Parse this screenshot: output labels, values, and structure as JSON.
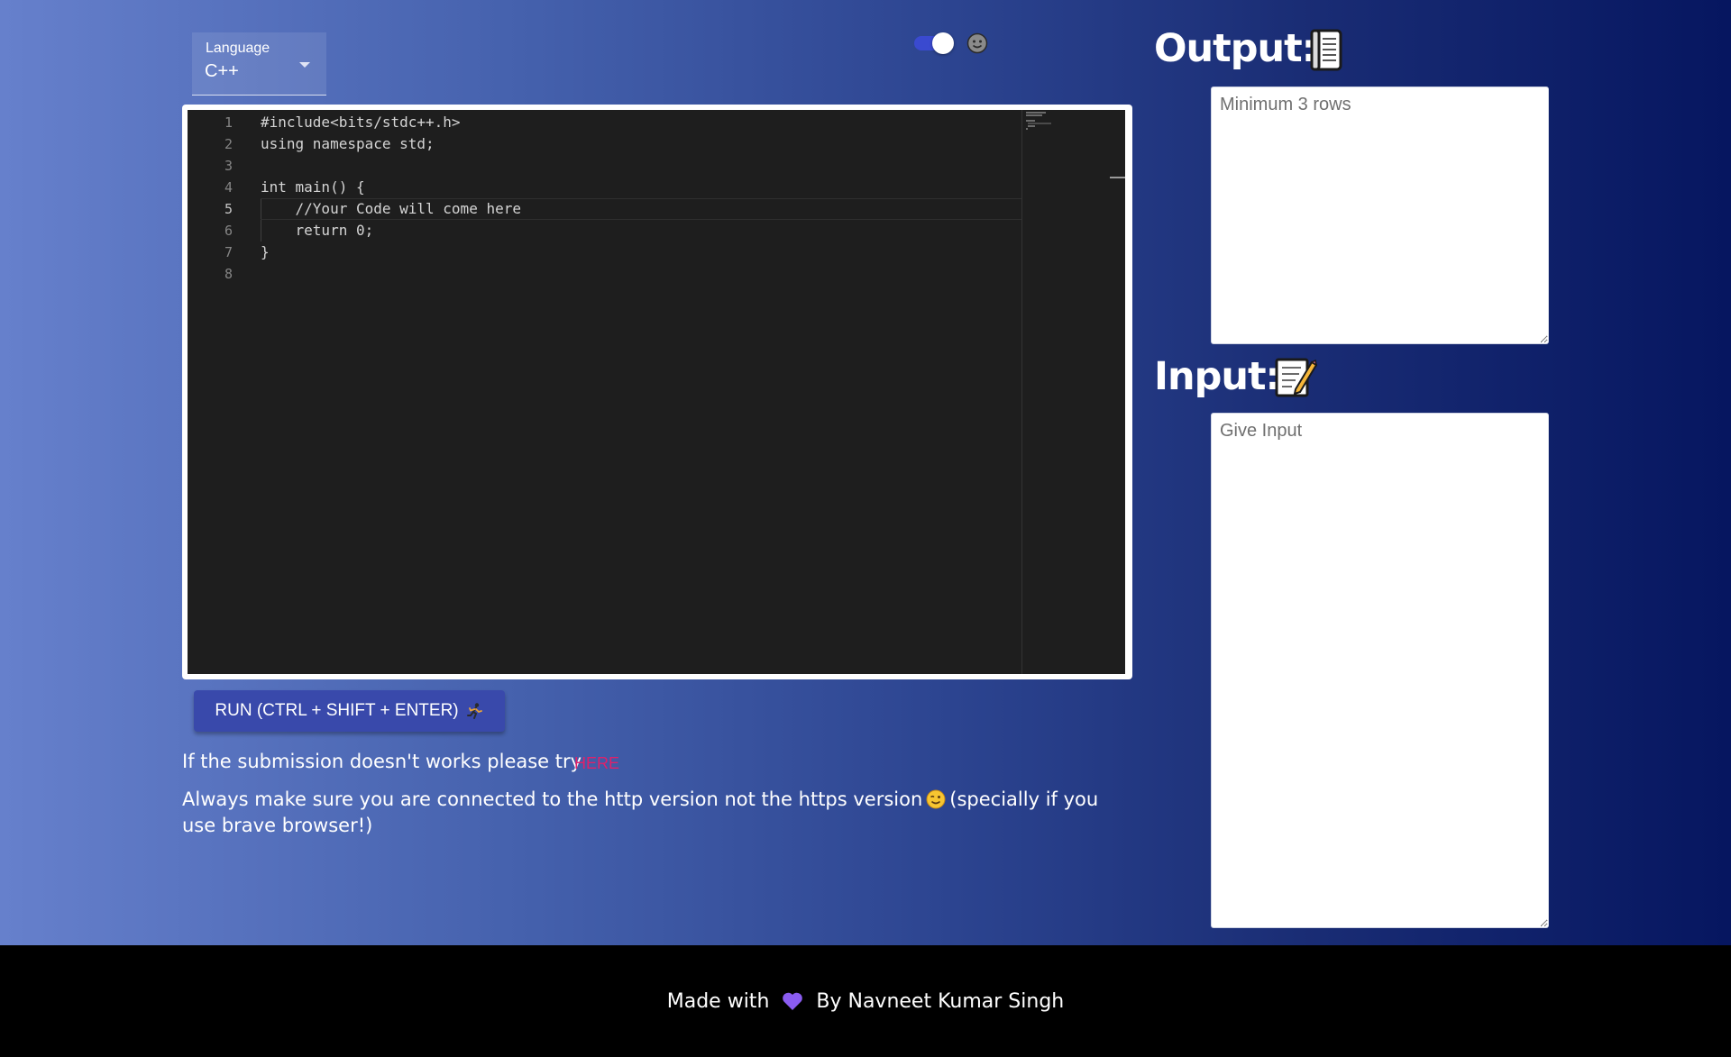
{
  "language_select": {
    "label": "Language",
    "value": "C++"
  },
  "theme_toggle": {
    "state": "on",
    "icon": "moon-face-icon"
  },
  "editor": {
    "line_numbers": [
      "1",
      "2",
      "3",
      "4",
      "5",
      "6",
      "7",
      "8"
    ],
    "lines": [
      "#include<bits/stdc++.h>",
      "using namespace std;",
      "",
      "int main() {",
      "    //Your Code will come here",
      "    return 0;",
      "}",
      ""
    ],
    "active_line": 5
  },
  "run_button": {
    "label": "RUN (CTRL + SHIFT + ENTER)",
    "icon": "runner-icon"
  },
  "notes": {
    "submission_text": "If the submission doesn't works please try",
    "here_link": "HERE",
    "http_text_before": "Always make sure you are connected to the http version not the https version",
    "http_text_after": "(specially if you use brave browser!)",
    "emoji": "winking-face-icon"
  },
  "output": {
    "title": "Output:",
    "icon": "page-facing-up-icon",
    "placeholder": "Minimum 3 rows"
  },
  "input": {
    "title": "Input:",
    "icon": "memo-icon",
    "placeholder": "Give Input"
  },
  "footer": {
    "made_with": "Made with",
    "by": "By Navneet Kumar Singh",
    "heart_icon": "purple-heart-icon",
    "heart_color": "#8a5cf0"
  },
  "colors": {
    "gradient_start": "#6680cc",
    "gradient_end": "#061660",
    "run_button": "#3949ab",
    "link": "#e0206a",
    "editor_bg": "#1e1e1e"
  }
}
